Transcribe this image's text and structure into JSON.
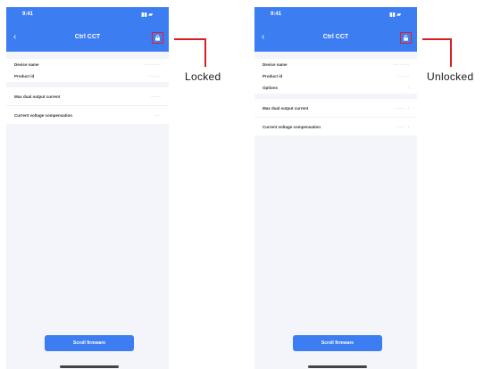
{
  "left_screen": {
    "status_time": "9:41",
    "status_icons": "▮▮ ▰",
    "title": "Ctrl CCT",
    "rows": [
      {
        "label": "Device name",
        "value": "············"
      },
      {
        "label": "Product id",
        "value": "·········"
      }
    ],
    "section": [
      {
        "label": "Max dual output current",
        "value": "········"
      },
      {
        "label": "Current voltage compensation",
        "value": "·····"
      }
    ],
    "button_label": "Scroll firmware"
  },
  "right_screen": {
    "status_time": "9:41",
    "status_icons": "▮▮ ▰",
    "title": "Ctrl CCT",
    "rows": [
      {
        "label": "Device name",
        "value": "············"
      },
      {
        "label": "Product id",
        "value": "·········"
      },
      {
        "label": "Options",
        "value": ""
      }
    ],
    "section": [
      {
        "label": "Max dual output current",
        "value": "·······"
      },
      {
        "label": "Current voltage compensation",
        "value": "·····"
      }
    ],
    "button_label": "Scroll firmware"
  },
  "annotations": {
    "left_label": "Locked",
    "right_label": "Unlocked",
    "callout_color": "#d81f26"
  },
  "colors": {
    "accent": "#3d7df2",
    "highlight": "#e0202a"
  },
  "icons": {
    "back": "chevron-left-icon",
    "lock": "lock-icon"
  }
}
